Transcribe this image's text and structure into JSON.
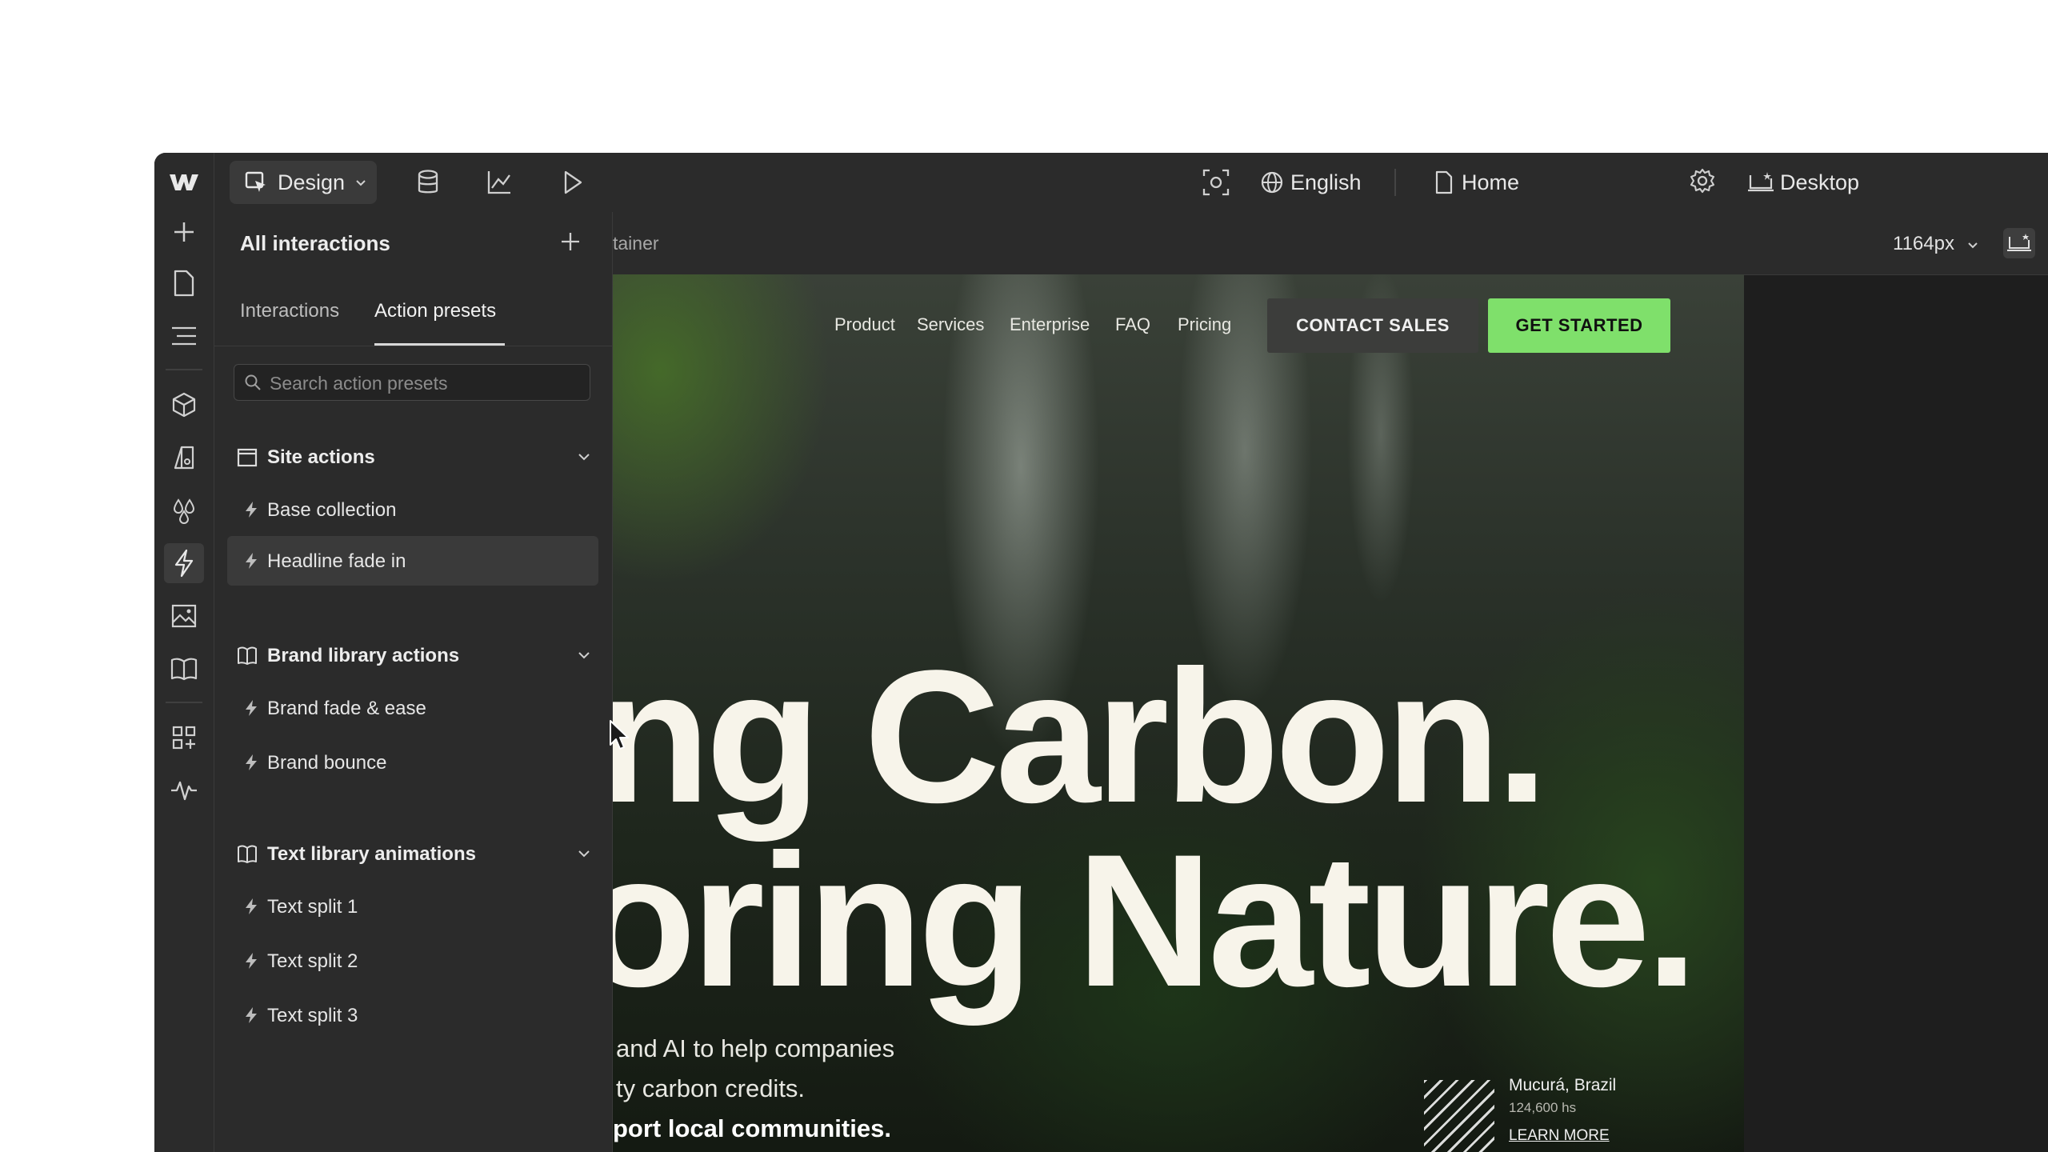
{
  "topbar": {
    "mode_label": "Design",
    "language_label": "English",
    "page_label": "Home",
    "breakpoint_label": "Desktop"
  },
  "panel": {
    "title": "All interactions",
    "tabs": [
      {
        "label": "Interactions"
      },
      {
        "label": "Action presets"
      }
    ],
    "search_placeholder": "Search action presets",
    "sections": [
      {
        "label": "Site actions",
        "items": [
          {
            "label": "Base collection"
          },
          {
            "label": "Headline fade in"
          }
        ]
      },
      {
        "label": "Brand library actions",
        "items": [
          {
            "label": "Brand fade & ease"
          },
          {
            "label": "Brand bounce"
          }
        ]
      },
      {
        "label": "Text library animations",
        "items": [
          {
            "label": "Text split 1"
          },
          {
            "label": "Text split 2"
          },
          {
            "label": "Text split 3"
          }
        ]
      }
    ]
  },
  "canvas": {
    "breadcrumb": "tainer",
    "width_label": "1164px"
  },
  "site": {
    "nav": [
      {
        "label": "Product"
      },
      {
        "label": "Services"
      },
      {
        "label": "Enterprise"
      },
      {
        "label": "FAQ"
      },
      {
        "label": "Pricing"
      }
    ],
    "cta_secondary": "CONTACT SALES",
    "cta_primary": "GET STARTED",
    "hero_line1": "ng Carbon.",
    "hero_line2": "oring Nature.",
    "sub_line1": "and AI to help companies",
    "sub_line2": "ty carbon credits.",
    "sub_line3": "port local communities.",
    "location_name": "Mucurá, Brazil",
    "location_area": "124,600 hs",
    "learn_more": "LEARN MORE"
  },
  "colors": {
    "accent_green": "#7fe06b",
    "ui_dark": "#2b2b2b"
  }
}
